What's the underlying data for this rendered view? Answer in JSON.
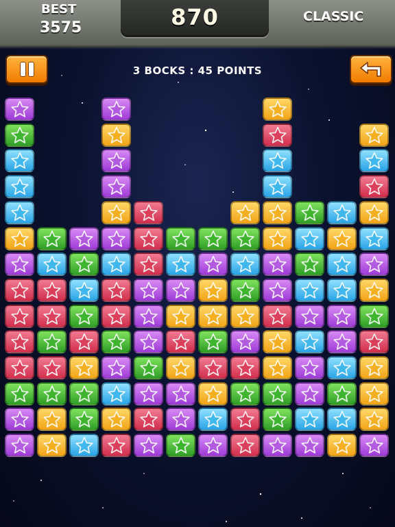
{
  "header": {
    "best_label": "BEST",
    "best_value": "3575",
    "score": "870",
    "mode": "CLASSIC"
  },
  "buttons": {
    "pause": "pause-icon",
    "undo": "undo-arrow-icon"
  },
  "info": "3 BOCKS : 45 POINTS",
  "colors": {
    "purple": "#b45fe6",
    "red": "#e4506b",
    "green": "#4cc23a",
    "yellow": "#f7bd33",
    "blue": "#4cc1f2",
    "button_orange": "#f7941d"
  },
  "board": {
    "rows": 14,
    "cols": 12,
    "columns": [
      [
        "P",
        "P",
        "G",
        "R",
        "R",
        "R",
        "R",
        "P",
        "Y",
        "B",
        "B",
        "B",
        "G",
        "P"
      ],
      [
        "Y",
        "Y",
        "G",
        "R",
        "G",
        "R",
        "R",
        "B",
        "G"
      ],
      [
        "B",
        "G",
        "G",
        "Y",
        "R",
        "G",
        "B",
        "G",
        "P"
      ],
      [
        "R",
        "Y",
        "B",
        "P",
        "G",
        "R",
        "R",
        "B",
        "P",
        "Y",
        "P",
        "P",
        "Y",
        "P"
      ],
      [
        "P",
        "R",
        "P",
        "G",
        "P",
        "P",
        "P",
        "R",
        "R",
        "R"
      ],
      [
        "G",
        "P",
        "P",
        "Y",
        "R",
        "Y",
        "P",
        "B",
        "G"
      ],
      [
        "P",
        "B",
        "Y",
        "R",
        "G",
        "Y",
        "Y",
        "P",
        "G"
      ],
      [
        "R",
        "R",
        "G",
        "R",
        "P",
        "Y",
        "G",
        "B",
        "G",
        "Y"
      ],
      [
        "P",
        "G",
        "G",
        "Y",
        "Y",
        "R",
        "P",
        "P",
        "Y",
        "Y",
        "B",
        "B",
        "R",
        "Y"
      ],
      [
        "P",
        "B",
        "P",
        "P",
        "B",
        "P",
        "B",
        "G",
        "B",
        "G"
      ],
      [
        "Y",
        "B",
        "G",
        "B",
        "P",
        "P",
        "B",
        "B",
        "Y",
        "B"
      ],
      [
        "P",
        "Y",
        "Y",
        "Y",
        "R",
        "G",
        "Y",
        "P",
        "B",
        "Y",
        "R",
        "B",
        "Y"
      ]
    ]
  }
}
